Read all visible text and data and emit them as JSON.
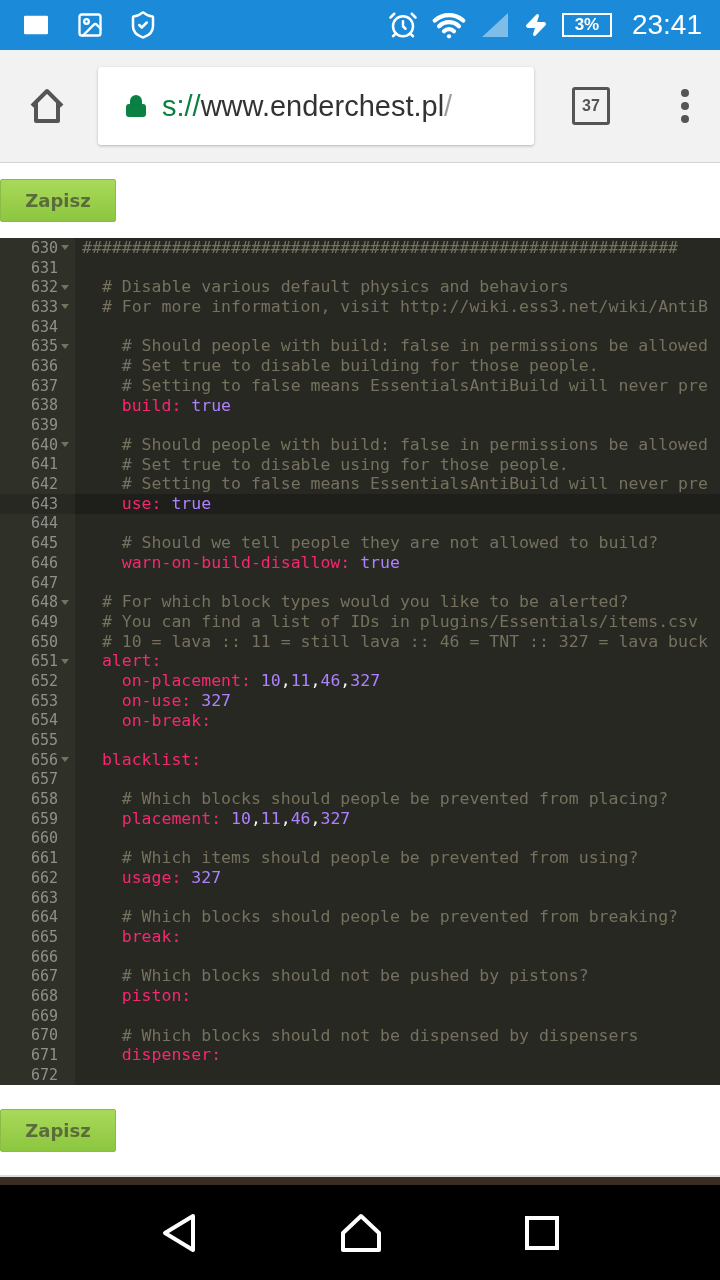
{
  "status_bar": {
    "battery": "3%",
    "time": "23:41"
  },
  "browser": {
    "url": {
      "scheme": "s://",
      "host": "www.enderchest.pl",
      "path": "/"
    },
    "tab_count": "37"
  },
  "save_buttons": [
    "Zapisz",
    "Zapisz"
  ],
  "editor": {
    "lines": [
      {
        "number": "630",
        "foldable": true,
        "current": false,
        "tokens": [
          {
            "kind": "comment",
            "text": "############################################################"
          }
        ]
      },
      {
        "number": "631",
        "foldable": false,
        "current": false
      },
      {
        "number": "632",
        "foldable": true,
        "current": false,
        "tokens": [
          {
            "kind": "comment",
            "text": "  # Disable various default physics and behaviors"
          }
        ]
      },
      {
        "number": "633",
        "foldable": true,
        "current": false,
        "tokens": [
          {
            "kind": "comment",
            "text": "  # For more information, visit http://wiki.ess3.net/wiki/AntiB"
          }
        ]
      },
      {
        "number": "634",
        "foldable": false,
        "current": false
      },
      {
        "number": "635",
        "foldable": true,
        "current": false,
        "tokens": [
          {
            "kind": "comment",
            "text": "    # Should people with build: false in permissions be allowed"
          }
        ]
      },
      {
        "number": "636",
        "foldable": false,
        "current": false,
        "tokens": [
          {
            "kind": "comment",
            "text": "    # Set true to disable building for those people."
          }
        ]
      },
      {
        "number": "637",
        "foldable": false,
        "current": false,
        "tokens": [
          {
            "kind": "comment",
            "text": "    # Setting to false means EssentialsAntiBuild will never pre"
          }
        ]
      },
      {
        "number": "638",
        "foldable": false,
        "current": false,
        "tokens": [
          {
            "kind": "key",
            "text": "    build:"
          },
          {
            "kind": "value",
            "text": " true"
          }
        ]
      },
      {
        "number": "639",
        "foldable": false,
        "current": false
      },
      {
        "number": "640",
        "foldable": true,
        "current": false,
        "tokens": [
          {
            "kind": "comment",
            "text": "    # Should people with build: false in permissions be allowed"
          }
        ]
      },
      {
        "number": "641",
        "foldable": false,
        "current": false,
        "tokens": [
          {
            "kind": "comment",
            "text": "    # Set true to disable using for those people."
          }
        ]
      },
      {
        "number": "642",
        "foldable": false,
        "current": false,
        "tokens": [
          {
            "kind": "comment",
            "text": "    # Setting to false means EssentialsAntiBuild will never pre"
          }
        ]
      },
      {
        "number": "643",
        "foldable": false,
        "current": true,
        "tokens": [
          {
            "kind": "key",
            "text": "    use:"
          },
          {
            "kind": "value",
            "text": " true"
          }
        ]
      },
      {
        "number": "644",
        "foldable": false,
        "current": false
      },
      {
        "number": "645",
        "foldable": false,
        "current": false,
        "tokens": [
          {
            "kind": "comment",
            "text": "    # Should we tell people they are not allowed to build?"
          }
        ]
      },
      {
        "number": "646",
        "foldable": false,
        "current": false,
        "tokens": [
          {
            "kind": "key",
            "text": "    warn-on-build-disallow:"
          },
          {
            "kind": "value",
            "text": " true"
          }
        ]
      },
      {
        "number": "647",
        "foldable": false,
        "current": false
      },
      {
        "number": "648",
        "foldable": true,
        "current": false,
        "tokens": [
          {
            "kind": "comment",
            "text": "  # For which block types would you like to be alerted?"
          }
        ]
      },
      {
        "number": "649",
        "foldable": false,
        "current": false,
        "tokens": [
          {
            "kind": "comment",
            "text": "  # You can find a list of IDs in plugins/Essentials/items.csv"
          }
        ]
      },
      {
        "number": "650",
        "foldable": false,
        "current": false,
        "tokens": [
          {
            "kind": "comment",
            "text": "  # 10 = lava :: 11 = still lava :: 46 = TNT :: 327 = lava buck"
          }
        ]
      },
      {
        "number": "651",
        "foldable": true,
        "current": false,
        "tokens": [
          {
            "kind": "key",
            "text": "  alert:"
          }
        ]
      },
      {
        "number": "652",
        "foldable": false,
        "current": false,
        "tokens": [
          {
            "kind": "key",
            "text": "    on-placement:"
          },
          {
            "kind": "value",
            "text": " 10,11,46,327"
          }
        ]
      },
      {
        "number": "653",
        "foldable": false,
        "current": false,
        "tokens": [
          {
            "kind": "key",
            "text": "    on-use:"
          },
          {
            "kind": "value",
            "text": " 327"
          }
        ]
      },
      {
        "number": "654",
        "foldable": false,
        "current": false,
        "tokens": [
          {
            "kind": "key",
            "text": "    on-break:"
          }
        ]
      },
      {
        "number": "655",
        "foldable": false,
        "current": false
      },
      {
        "number": "656",
        "foldable": true,
        "current": false,
        "tokens": [
          {
            "kind": "key",
            "text": "  blacklist:"
          }
        ]
      },
      {
        "number": "657",
        "foldable": false,
        "current": false
      },
      {
        "number": "658",
        "foldable": false,
        "current": false,
        "tokens": [
          {
            "kind": "comment",
            "text": "    # Which blocks should people be prevented from placing?"
          }
        ]
      },
      {
        "number": "659",
        "foldable": false,
        "current": false,
        "tokens": [
          {
            "kind": "key",
            "text": "    placement:"
          },
          {
            "kind": "value",
            "text": " 10,11,46,327"
          }
        ]
      },
      {
        "number": "660",
        "foldable": false,
        "current": false
      },
      {
        "number": "661",
        "foldable": false,
        "current": false,
        "tokens": [
          {
            "kind": "comment",
            "text": "    # Which items should people be prevented from using?"
          }
        ]
      },
      {
        "number": "662",
        "foldable": false,
        "current": false,
        "tokens": [
          {
            "kind": "key",
            "text": "    usage:"
          },
          {
            "kind": "value",
            "text": " 327"
          }
        ]
      },
      {
        "number": "663",
        "foldable": false,
        "current": false
      },
      {
        "number": "664",
        "foldable": false,
        "current": false,
        "tokens": [
          {
            "kind": "comment",
            "text": "    # Which blocks should people be prevented from breaking?"
          }
        ]
      },
      {
        "number": "665",
        "foldable": false,
        "current": false,
        "tokens": [
          {
            "kind": "key",
            "text": "    break:"
          }
        ]
      },
      {
        "number": "666",
        "foldable": false,
        "current": false
      },
      {
        "number": "667",
        "foldable": false,
        "current": false,
        "tokens": [
          {
            "kind": "comment",
            "text": "    # Which blocks should not be pushed by pistons?"
          }
        ]
      },
      {
        "number": "668",
        "foldable": false,
        "current": false,
        "tokens": [
          {
            "kind": "key",
            "text": "    piston:"
          }
        ]
      },
      {
        "number": "669",
        "foldable": false,
        "current": false
      },
      {
        "number": "670",
        "foldable": false,
        "current": false,
        "tokens": [
          {
            "kind": "comment",
            "text": "    # Which blocks should not be dispensed by dispensers"
          }
        ]
      },
      {
        "number": "671",
        "foldable": false,
        "current": false,
        "tokens": [
          {
            "kind": "key",
            "text": "    dispenser:"
          }
        ]
      },
      {
        "number": "672",
        "foldable": false,
        "current": false
      }
    ]
  }
}
